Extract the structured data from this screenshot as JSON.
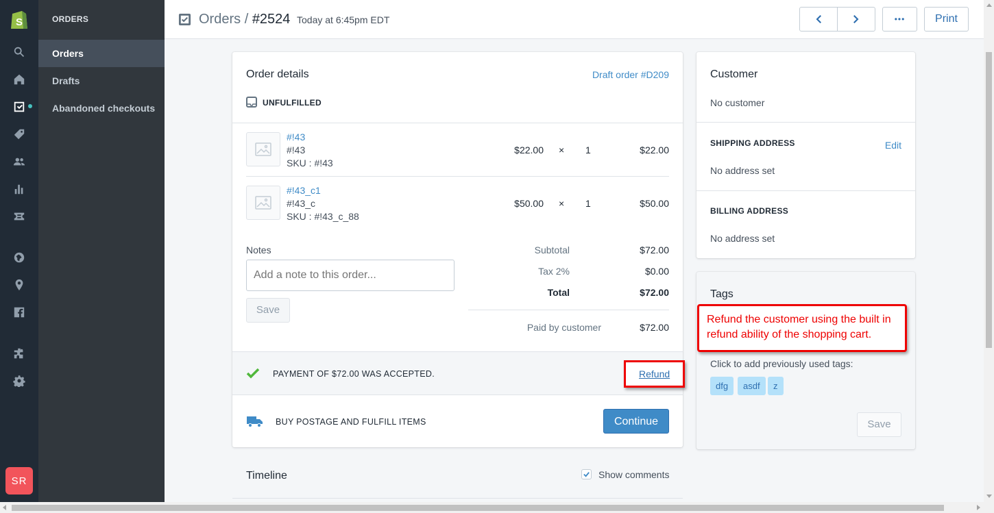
{
  "app": {
    "avatar_initials": "SR",
    "accent": "#5c6ac4",
    "link_color": "#3f8bc7",
    "primary_button": "#3f8bc7",
    "annotation_color": "#e00000"
  },
  "rail": {
    "icons": [
      "shopify-logo",
      "search-icon",
      "home-icon",
      "orders-icon",
      "products-icon",
      "customers-icon",
      "analytics-icon",
      "discounts-icon",
      "online-store-icon",
      "location-icon",
      "facebook-icon",
      "apps-icon",
      "settings-icon"
    ]
  },
  "subnav": {
    "section": "ORDERS",
    "items": [
      "Orders",
      "Drafts",
      "Abandoned checkouts"
    ]
  },
  "header": {
    "breadcrumb_parent": "Orders",
    "separator": "/",
    "order_number": "#2524",
    "date": "Today at 6:45pm EDT",
    "more_label": "•••",
    "print_label": "Print"
  },
  "order": {
    "title": "Order details",
    "draft_link": "Draft order #D209",
    "fulfillment_status": "UNFULFILLED",
    "line_items": [
      {
        "name": "#!43",
        "variant": "#!43",
        "sku": "SKU : #!43",
        "price": "$22.00",
        "times": "×",
        "qty": "1",
        "total": "$22.00"
      },
      {
        "name": "#!43_c1",
        "variant": "#!43_c",
        "sku": "SKU : #!43_c_88",
        "price": "$50.00",
        "times": "×",
        "qty": "1",
        "total": "$50.00"
      }
    ],
    "notes_label": "Notes",
    "notes_placeholder": "Add a note to this order...",
    "save_label": "Save",
    "summary": [
      {
        "label": "Subtotal",
        "value": "$72.00"
      },
      {
        "label": "Tax 2%",
        "value": "$0.00"
      },
      {
        "label": "Total",
        "value": "$72.00"
      }
    ],
    "paid_label": "Paid by customer",
    "paid_value": "$72.00",
    "payment_message": "PAYMENT OF $72.00 WAS ACCEPTED.",
    "refund_label": "Refund",
    "fulfill_message": "BUY POSTAGE AND FULFILL ITEMS",
    "continue_label": "Continue"
  },
  "timeline": {
    "title": "Timeline",
    "show_comments": "Show comments"
  },
  "customer": {
    "title": "Customer",
    "no_customer": "No customer",
    "shipping_title": "SHIPPING ADDRESS",
    "edit_label": "Edit",
    "shipping_value": "No address set",
    "billing_title": "BILLING ADDRESS",
    "billing_value": "No address set"
  },
  "tags": {
    "title": "Tags",
    "hint": "Click to add previously used tags:",
    "items": [
      "dfg",
      "asdf",
      "z"
    ],
    "save_label": "Save"
  },
  "annotation": {
    "text": "Refund the customer using the built in refund ability of the shopping cart."
  }
}
